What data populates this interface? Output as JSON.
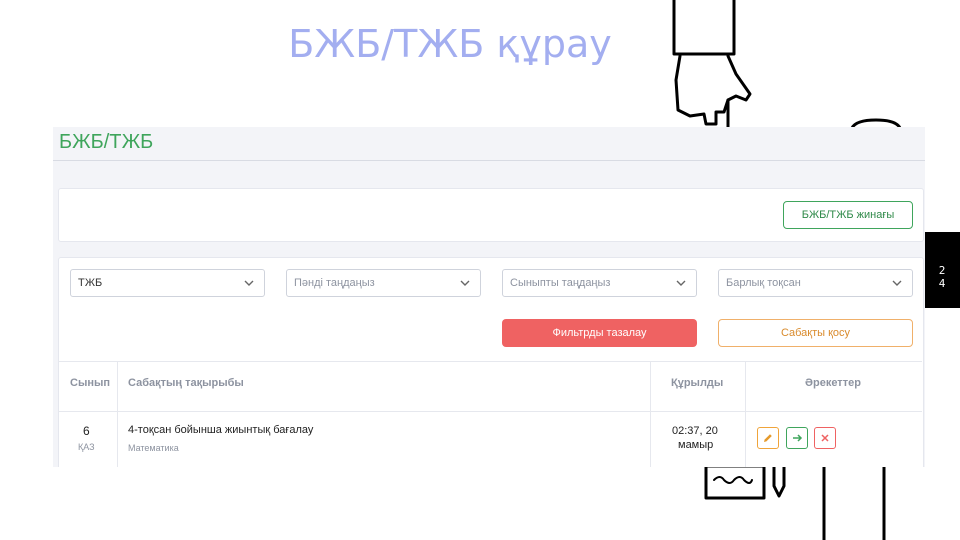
{
  "slide": {
    "title": "БЖБ/ТЖБ құрау",
    "page_number_top": "2",
    "page_number_bottom": "4"
  },
  "app": {
    "header_title": "БЖБ/ТЖБ",
    "create_button": "БЖБ/ТЖБ жинағы",
    "filters": {
      "type_value": "ТЖБ",
      "subject_placeholder": "Пәнді таңдаңыз",
      "class_placeholder": "Сыныпты таңдаңыз",
      "quarter_value": "Барлық тоқсан"
    },
    "clear_filters_button": "Фильтрды тазалау",
    "add_lesson_button": "Сабақты қосу",
    "table": {
      "headers": [
        "Сынып",
        "Сабақтың тақырыбы",
        "Құрылды",
        "Әрекеттер"
      ],
      "rows": [
        {
          "class_num": "6",
          "class_lang": "ҚАЗ",
          "topic": "4-тоқсан бойынша жиынтық бағалау",
          "subject": "Математика",
          "created_line1": "02:37, 20",
          "created_line2": "мамыр"
        }
      ]
    }
  },
  "colors": {
    "title": "#a3aef0",
    "accent_green": "#3fa55c",
    "danger": "#ef6262",
    "warning": "#f0b06a"
  },
  "icons": [
    "chevron-down-icon",
    "pencil-icon",
    "arrow-right-icon",
    "close-icon"
  ]
}
